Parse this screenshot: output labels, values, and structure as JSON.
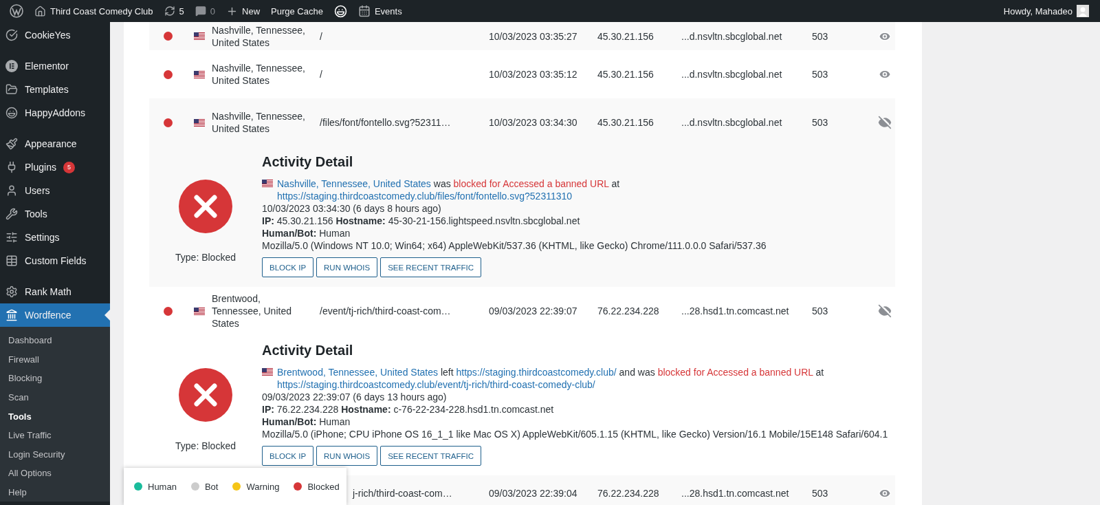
{
  "admin_bar": {
    "site": "Third Coast Comedy Club",
    "updates": "5",
    "comments": "0",
    "new": "New",
    "purge": "Purge Cache",
    "events": "Events",
    "greeting": "Howdy, Mahadeo"
  },
  "sidebar": {
    "groups": [
      {
        "items": [
          {
            "label": "CookieYes",
            "selected": false
          }
        ]
      },
      {
        "items": [
          {
            "label": "Elementor",
            "selected": false
          },
          {
            "label": "Templates",
            "selected": false
          },
          {
            "label": "HappyAddons",
            "selected": false
          }
        ]
      },
      {
        "items": [
          {
            "label": "Appearance",
            "selected": false
          },
          {
            "label": "Plugins",
            "selected": false,
            "badge": "5"
          },
          {
            "label": "Users",
            "selected": false
          },
          {
            "label": "Tools",
            "selected": false
          },
          {
            "label": "Settings",
            "selected": false
          },
          {
            "label": "Custom Fields",
            "selected": false
          }
        ]
      },
      {
        "items": [
          {
            "label": "Rank Math",
            "selected": false
          },
          {
            "label": "Wordfence",
            "selected": true,
            "children": [
              {
                "label": "Dashboard",
                "selected": false
              },
              {
                "label": "Firewall",
                "selected": false
              },
              {
                "label": "Blocking",
                "selected": false
              },
              {
                "label": "Scan",
                "selected": false
              },
              {
                "label": "Tools",
                "selected": true
              },
              {
                "label": "Live Traffic",
                "selected": false
              },
              {
                "label": "Login Security",
                "selected": false
              },
              {
                "label": "All Options",
                "selected": false
              },
              {
                "label": "Help",
                "selected": false
              }
            ]
          }
        ]
      }
    ]
  },
  "traffic": {
    "rows": [
      {
        "color": "#d63638",
        "location": "Nashville, Tennessee, United States",
        "url": "/",
        "time": "10/03/2023 03:35:27",
        "ip": "45.30.21.156",
        "hostname": "...d.nsvltn.sbcglobal.net",
        "status": "503",
        "expanded": false
      },
      {
        "color": "#d63638",
        "location": "Nashville, Tennessee, United States",
        "url": "/",
        "time": "10/03/2023 03:35:12",
        "ip": "45.30.21.156",
        "hostname": "...d.nsvltn.sbcglobal.net",
        "status": "503",
        "expanded": false
      },
      {
        "color": "#d63638",
        "location": "Nashville, Tennessee, United States",
        "url": "/files/font/fontello.svg?52311…",
        "time": "10/03/2023 03:34:30",
        "ip": "45.30.21.156",
        "hostname": "...d.nsvltn.sbcglobal.net",
        "status": "503",
        "expanded": true,
        "detail": {
          "type": "Type: Blocked",
          "title": "Activity Detail",
          "message": [
            {
              "kind": "link",
              "text": "Nashville, Tennessee, United States"
            },
            {
              "kind": "text",
              "text": " was "
            },
            {
              "kind": "alert",
              "text": "blocked for Accessed a banned URL"
            },
            {
              "kind": "text",
              "text": " at "
            },
            {
              "kind": "link",
              "text": "https://staging.thirdcoastcomedy.club/files/font/fontello.svg?52311310"
            }
          ],
          "time": "10/03/2023 03:34:30 (6 days 8 hours ago)",
          "network": "**IP:** 45.30.21.156 **Hostname:** 45-30-21-156.lightspeed.nsvltn.sbcglobal.net",
          "human_bot": "**Human/Bot:** Human",
          "user_agent": "Mozilla/5.0 (Windows NT 10.0; Win64; x64) AppleWebKit/537.36 (KHTML, like Gecko) Chrome/111.0.0.0 Safari/537.36",
          "buttons": [
            "BLOCK IP",
            "RUN WHOIS",
            "SEE RECENT TRAFFIC"
          ]
        }
      },
      {
        "color": "#d63638",
        "location": "Brentwood, Tennessee, United States",
        "url": "/event/tj-rich/third-coast-com…",
        "time": "09/03/2023 22:39:07",
        "ip": "76.22.234.228",
        "hostname": "...28.hsd1.tn.comcast.net",
        "status": "503",
        "expanded": true,
        "detail": {
          "type": "Type: Blocked",
          "title": "Activity Detail",
          "message": [
            {
              "kind": "link",
              "text": "Brentwood, Tennessee, United States"
            },
            {
              "kind": "text",
              "text": " left "
            },
            {
              "kind": "link",
              "text": "https://staging.thirdcoastcomedy.club/"
            },
            {
              "kind": "text",
              "text": " and was "
            },
            {
              "kind": "alert",
              "text": "blocked for Accessed a banned URL"
            },
            {
              "kind": "text",
              "text": " at "
            },
            {
              "kind": "link",
              "text": "https://staging.thirdcoastcomedy.club/event/tj-rich/third-coast-comedy-club/"
            }
          ],
          "time": "09/03/2023 22:39:07 (6 days 13 hours ago)",
          "network": "**IP:** 76.22.234.228 **Hostname:** c-76-22-234-228.hsd1.tn.comcast.net",
          "human_bot": "**Human/Bot:** Human",
          "user_agent": "Mozilla/5.0 (iPhone; CPU iPhone OS 16_1_1 like Mac OS X) AppleWebKit/605.1.15 (KHTML, like Gecko) Version/16.1 Mobile/15E148 Safari/604.1",
          "buttons": [
            "BLOCK IP",
            "RUN WHOIS",
            "SEE RECENT TRAFFIC"
          ]
        }
      },
      {
        "url": "j-rich/third-coast-com…",
        "time": "09/03/2023 22:39:04",
        "ip": "76.22.234.228",
        "hostname": "...28.hsd1.tn.comcast.net",
        "status": "503",
        "expanded": false
      }
    ]
  },
  "legend": [
    {
      "label": "Human",
      "color": "#1abc9c"
    },
    {
      "label": "Bot",
      "color": "#cccccc"
    },
    {
      "label": "Warning",
      "color": "#f5c518"
    },
    {
      "label": "Blocked",
      "color": "#d63638"
    }
  ]
}
